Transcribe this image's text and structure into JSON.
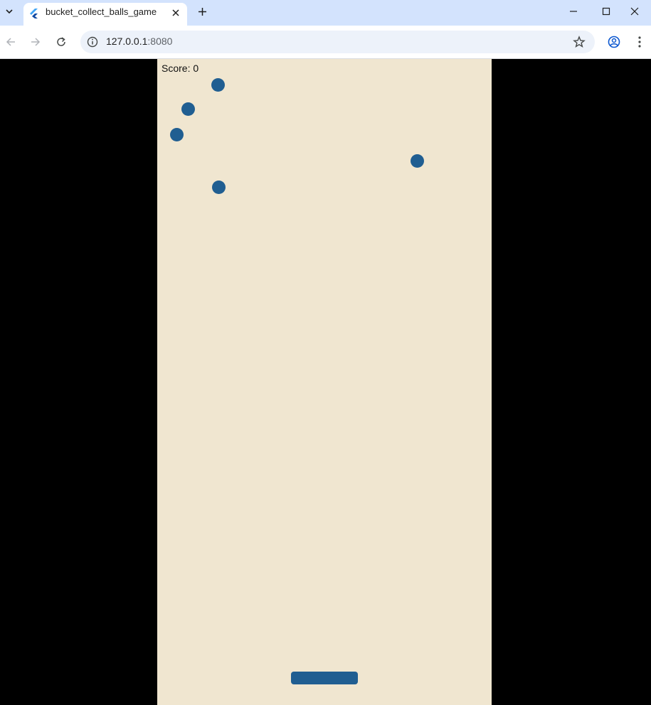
{
  "browser": {
    "tab_title": "bucket_collect_balls_game",
    "url_host": "127.0.0.1",
    "url_port": ":8080",
    "icons": {
      "tab_list": "chevron-down-icon",
      "favicon": "flutter-icon",
      "tab_close": "close-icon",
      "new_tab": "plus-icon",
      "minimize": "minimize-icon",
      "maximize": "maximize-icon",
      "close_window": "close-icon",
      "back": "arrow-left-icon",
      "forward": "arrow-right-icon",
      "reload": "reload-icon",
      "site_info": "info-icon",
      "bookmark": "star-icon",
      "profile": "account-icon",
      "menu": "more-vert-icon"
    },
    "colors": {
      "tabstrip": "#d3e3fd",
      "omnibox": "#edf2fa"
    }
  },
  "game": {
    "score_label": "Score: 0",
    "ball_count": 5,
    "colors": {
      "background": "#f0e6d0",
      "ball": "#205e91",
      "bucket": "#205e91",
      "letterbox": "#000000"
    }
  }
}
